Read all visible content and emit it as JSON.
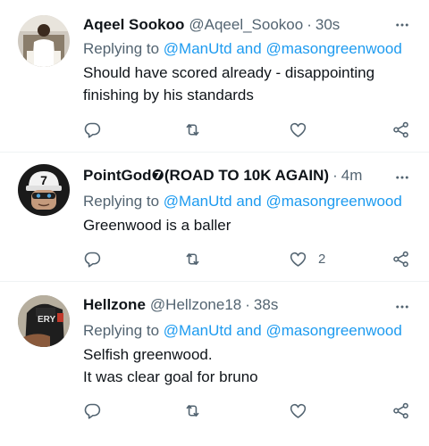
{
  "tweets": [
    {
      "name": "Aqeel Sookoo",
      "handle": "@Aqeel_Sookoo",
      "separator": "·",
      "time": "30s",
      "replying_prefix": "Replying to",
      "mention_1": "@ManUtd",
      "mention_join": "and",
      "mention_2": "@masongreenwood",
      "lines": [
        "Should have scored already - disappointing",
        "finishing by his standards"
      ],
      "like_count": ""
    },
    {
      "name": "PointGod❼(ROAD TO 10K AGAIN)",
      "handle": "",
      "separator": "·",
      "time": "4m",
      "replying_prefix": "Replying to",
      "mention_1": "@ManUtd",
      "mention_join": "and",
      "mention_2": "@masongreenwood",
      "lines": [
        "Greenwood is a baller"
      ],
      "like_count": "2"
    },
    {
      "name": "Hellzone",
      "handle": "@Hellzone18",
      "separator": "·",
      "time": "38s",
      "replying_prefix": "Replying to",
      "mention_1": "@ManUtd",
      "mention_join": "and",
      "mention_2": "@masongreenwood",
      "lines": [
        "Selfish greenwood.",
        "It was clear goal for bruno"
      ],
      "like_count": ""
    }
  ],
  "colors": {
    "text": "#0f1419",
    "secondary": "#536471",
    "link": "#1d9bf0",
    "divider": "#eff3f4"
  },
  "icons": {
    "reply": "reply-icon",
    "retweet": "retweet-icon",
    "like": "heart-icon",
    "share": "share-icon",
    "more": "more-options-icon"
  }
}
